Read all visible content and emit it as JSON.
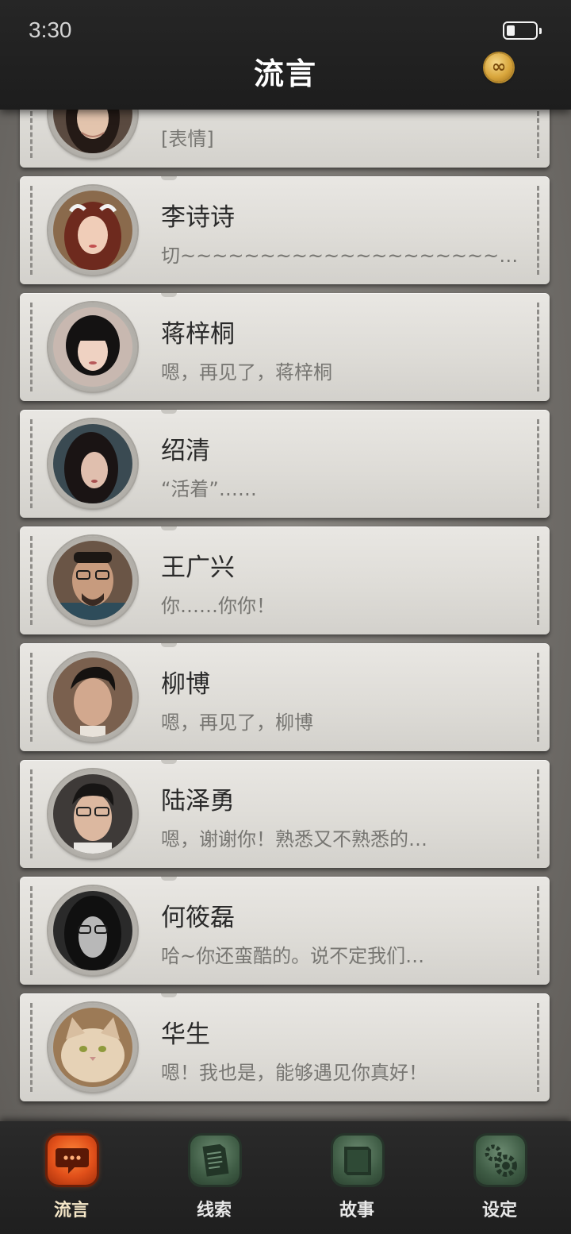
{
  "status_bar": {
    "time": "3:30",
    "battery_level": 0.3
  },
  "header": {
    "title": "流言",
    "coin_icon": "infinity-coin-icon",
    "coin_symbol": "∞"
  },
  "messages": [
    {
      "name": "",
      "preview": "[表情]",
      "avatar": "female-portrait-long-dark-hair"
    },
    {
      "name": "李诗诗",
      "preview": "切~~~~~~~~~~~~~~~~~~~~~…",
      "avatar": "female-portrait-auburn-hair-white-bow"
    },
    {
      "name": "蒋梓桐",
      "preview": "嗯，再见了，蒋梓桐",
      "avatar": "female-portrait-black-bob"
    },
    {
      "name": "绍清",
      "preview": "“活着”……",
      "avatar": "female-portrait-long-black-hair"
    },
    {
      "name": "王广兴",
      "preview": "你……你你！",
      "avatar": "male-portrait-glasses-beard"
    },
    {
      "name": "柳博",
      "preview": "嗯，再见了，柳博",
      "avatar": "male-portrait-slick-hair"
    },
    {
      "name": "陆泽勇",
      "preview": "嗯，谢谢你！熟悉又不熟悉的…",
      "avatar": "male-portrait-glasses"
    },
    {
      "name": "何筱磊",
      "preview": "哈~你还蛮酷的。说不定我们…",
      "avatar": "male-portrait-grayscale-glasses"
    },
    {
      "name": "华生",
      "preview": "嗯！我也是，能够遇见你真好！",
      "avatar": "cat-portrait"
    }
  ],
  "nav": [
    {
      "label": "流言",
      "icon": "chat-bubble-icon",
      "active": true
    },
    {
      "label": "线索",
      "icon": "notes-icon",
      "active": false
    },
    {
      "label": "故事",
      "icon": "book-icon",
      "active": false
    },
    {
      "label": "设定",
      "icon": "gear-icon",
      "active": false
    }
  ]
}
